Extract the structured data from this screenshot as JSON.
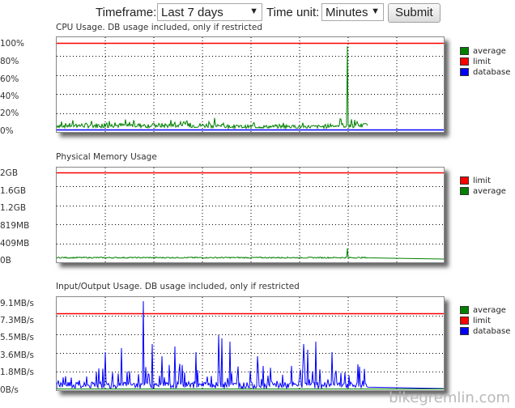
{
  "toolbar": {
    "timeframe_label": "Timeframe:",
    "timeframe_value": "Last 7 days",
    "timeunit_label": "Time unit:",
    "timeunit_value": "Minutes",
    "submit_label": "Submit"
  },
  "charts": {
    "cpu": {
      "title": "CPU Usage. DB usage included, only if restricted",
      "yticks": [
        "100%",
        "80%",
        "60%",
        "40%",
        "20%",
        "0%"
      ],
      "legend": [
        {
          "label": "average",
          "color": "#008000"
        },
        {
          "label": "limit",
          "color": "#ff0000"
        },
        {
          "label": "database",
          "color": "#0000ff"
        }
      ]
    },
    "memory": {
      "title": "Physical Memory Usage",
      "yticks": [
        "2GB",
        "1.6GB",
        "1.2GB",
        "819MB",
        "409MB",
        "0B"
      ],
      "legend": [
        {
          "label": "limit",
          "color": "#ff0000"
        },
        {
          "label": "average",
          "color": "#008000"
        }
      ]
    },
    "io": {
      "title": "Input/Output Usage. DB usage included, only if restricted",
      "yticks": [
        "9.1MB/s",
        "7.3MB/s",
        "5.5MB/s",
        "3.6MB/s",
        "1.8MB/s",
        "0B/s"
      ],
      "legend": [
        {
          "label": "average",
          "color": "#008000"
        },
        {
          "label": "limit",
          "color": "#ff0000"
        },
        {
          "label": "database",
          "color": "#0000ff"
        }
      ]
    }
  },
  "chart_data": [
    {
      "type": "line",
      "title": "CPU Usage. DB usage included, only if restricted",
      "ylim": [
        0,
        100
      ],
      "series": [
        {
          "name": "limit",
          "values": [
            100
          ]
        },
        {
          "name": "average",
          "peak": 97
        }
      ]
    },
    {
      "type": "line",
      "title": "Physical Memory Usage",
      "series": [
        {
          "name": "limit",
          "values": [
            "2GB"
          ]
        }
      ]
    },
    {
      "type": "line",
      "title": "Input/Output Usage. DB usage included, only if restricted",
      "series": [
        {
          "name": "limit",
          "values": [
            "8MB/s"
          ]
        },
        {
          "name": "database",
          "peak": "9.1MB/s"
        }
      ]
    }
  ],
  "watermark": "bikegremlin.com"
}
